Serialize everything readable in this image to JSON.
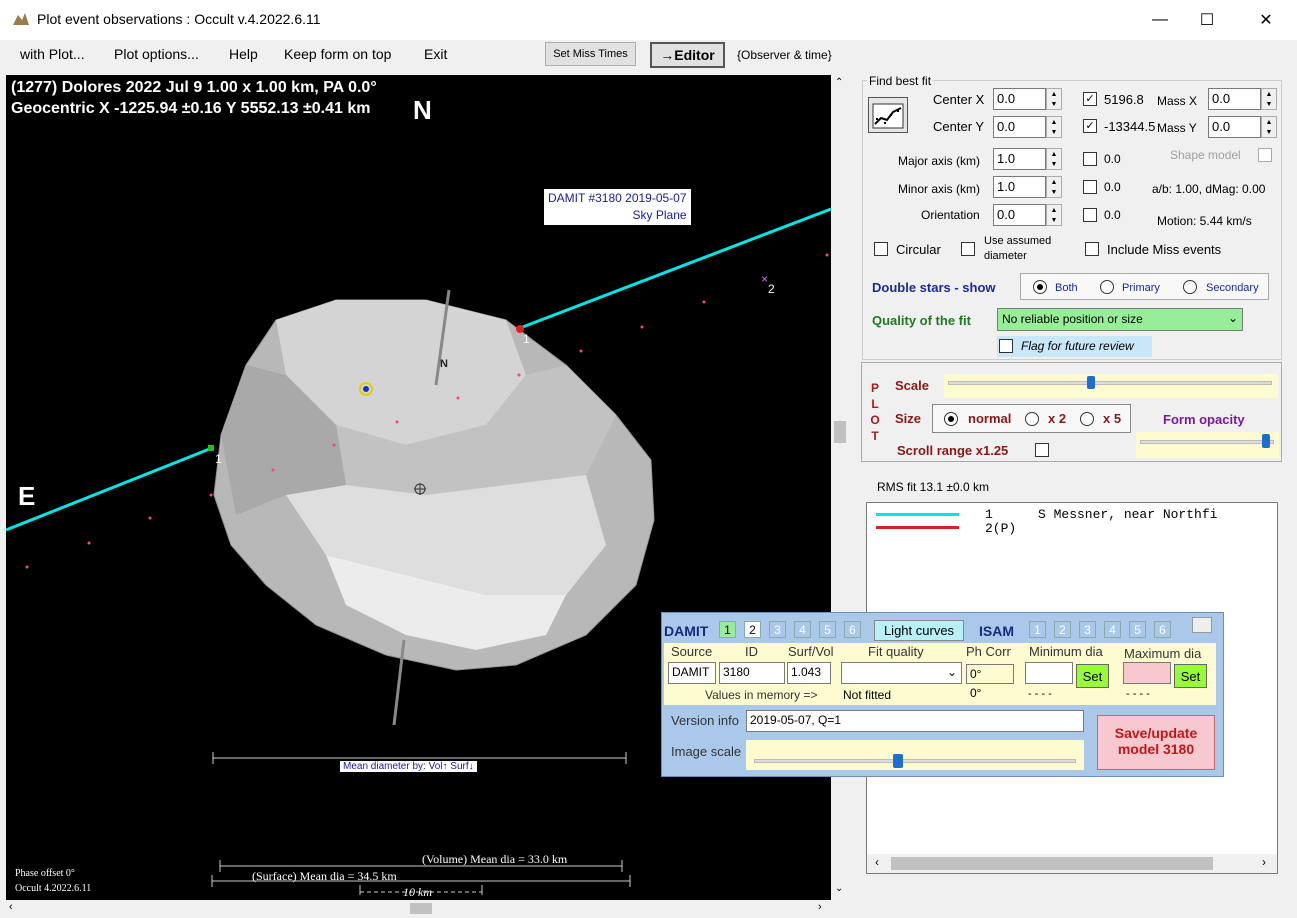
{
  "window": {
    "title": "Plot event observations : Occult v.4.2022.6.11",
    "minimize": "—",
    "maximize": "☐",
    "close": "✕"
  },
  "menu": {
    "items": [
      "with Plot...",
      "Plot options...",
      "Help",
      "Keep form on top",
      "Exit"
    ],
    "set_miss_times": "Set Miss Times",
    "editor": "→Editor",
    "observer_time": "{Observer & time}"
  },
  "plot": {
    "header_line1": "(1277) Dolores  2022 Jul 9   1.00 x 1.00 km, PA 0.0°",
    "header_line2": "Geocentric X  -1225.94 ±0.16  Y 5552.13 ±0.41 km",
    "north_label": "N",
    "east_label": "E",
    "model_north_label": "N",
    "damit_label_line1": "DAMIT #3180 2019-05-07",
    "damit_label_line2": "Sky Plane",
    "chord1_label": "1",
    "chord1_label_b": "1",
    "miss_label": "2",
    "mean_dia_tag": "Mean diameter by: Vol↑ Surf↓",
    "volume_mean": "(Volume) Mean dia = 33.0 km",
    "surface_mean": "(Surface) Mean dia = 34.5 km",
    "scale_bar": "10 km",
    "phase_offset": "Phase offset 0°",
    "version": "Occult 4.2022.6.11",
    "colors": {
      "chord1": "#00e5e5",
      "chord2": "#ff2020",
      "background": "#000000"
    }
  },
  "fit": {
    "find_best_fit": "Find best fit",
    "center_x_label": "Center X",
    "center_x": "0.0",
    "center_y_label": "Center Y",
    "center_y": "0.0",
    "mass_x_val": "5196.8",
    "mass_x_label": "Mass X",
    "mass_x": "0.0",
    "mass_y_val": "-13344.5",
    "mass_y_label": "Mass Y",
    "mass_y": "0.0",
    "major_label": "Major axis (km)",
    "major": "1.0",
    "major_chk": "0.0",
    "minor_label": "Minor axis (km)",
    "minor": "1.0",
    "minor_chk": "0.0",
    "orient_label": "Orientation",
    "orient": "0.0",
    "orient_chk": "0.0",
    "shape_model": "Shape model",
    "ab_dmag": "a/b: 1.00, dMag: 0.00",
    "motion": "Motion: 5.44 km/s",
    "circular": "Circular",
    "use_assumed_1": "Use assumed",
    "use_assumed_2": "diameter",
    "include_miss": "Include Miss events",
    "double_stars": "Double stars - show",
    "both": "Both",
    "primary": "Primary",
    "secondary": "Secondary",
    "quality_label": "Quality of the fit",
    "quality_value": "No reliable position or size",
    "flag_review": "Flag for future review"
  },
  "plotopts": {
    "p": "P",
    "l": "L",
    "o": "O",
    "t": "T",
    "scale": "Scale",
    "size": "Size",
    "normal": "normal",
    "x2": "x 2",
    "x5": "x 5",
    "form_opacity": "Form opacity",
    "scroll_range": "Scroll range x1.25"
  },
  "rms": "RMS fit 13.1 ±0.0 km",
  "observers": [
    {
      "num": "1",
      "name": "S Messner, near Northfi"
    },
    {
      "num": "2(P)",
      "name": ""
    }
  ],
  "damit": {
    "title": "DAMIT",
    "nums": [
      "1",
      "2",
      "3",
      "4",
      "5",
      "6"
    ],
    "light_curves": "Light curves",
    "isam": "ISAM",
    "isam_nums": [
      "1",
      "2",
      "3",
      "4",
      "5",
      "6"
    ],
    "source_h": "Source",
    "id_h": "ID",
    "surfvol_h": "Surf/Vol",
    "fitq_h": "Fit quality",
    "phcorr_h": "Ph Corr",
    "mindia_h": "Minimum dia",
    "maxdia_h": "Maximum dia",
    "source": "DAMIT",
    "id": "3180",
    "surfvol": "1.043",
    "phcorr": "0°",
    "set": "Set",
    "values_in_memory": "Values in memory =>",
    "not_fitted": "Not fitted",
    "phcorr_mem": "0°",
    "min_mem": "- - - -",
    "max_mem": "- - - -",
    "version_label": "Version info",
    "version": "2019-05-07, Q=1",
    "image_scale": "Image scale",
    "save_line1": "Save/update",
    "save_line2": "model 3180"
  }
}
